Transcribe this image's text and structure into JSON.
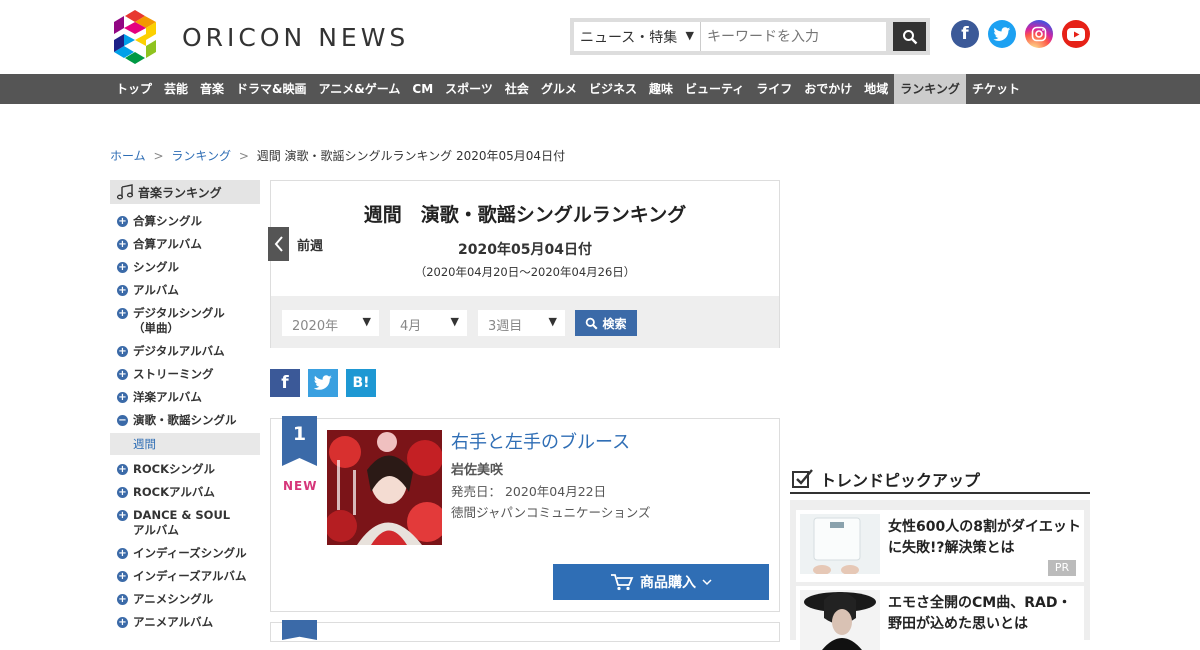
{
  "header": {
    "logo_text": "ORICON NEWS",
    "search": {
      "category": "ニュース・特集",
      "placeholder": "キーワードを入力"
    },
    "social": [
      {
        "name": "facebook",
        "glyph": "f",
        "color": "#3b5998"
      },
      {
        "name": "twitter",
        "glyph": "t",
        "color": "#1da1f2"
      },
      {
        "name": "instagram",
        "glyph": "◎",
        "color": "#c13584"
      },
      {
        "name": "youtube",
        "glyph": "▶",
        "color": "#e62117"
      }
    ]
  },
  "nav": {
    "items": [
      "トップ",
      "芸能",
      "音楽",
      "ドラマ&映画",
      "アニメ&ゲーム",
      "CM",
      "スポーツ",
      "社会",
      "グルメ",
      "ビジネス",
      "趣味",
      "ビューティ",
      "ライフ",
      "おでかけ",
      "地域",
      "ランキング",
      "チケット"
    ],
    "active_index": 15
  },
  "breadcrumb": {
    "home": "ホーム",
    "ranking": "ランキング",
    "current": "週間 演歌・歌謡シングルランキング 2020年05月04日付",
    "separator": ">"
  },
  "sidebar": {
    "heading": "音楽ランキング",
    "items": [
      {
        "label": "合算シングル",
        "symbol": "+"
      },
      {
        "label": "合算アルバム",
        "symbol": "+"
      },
      {
        "label": "シングル",
        "symbol": "+"
      },
      {
        "label": "アルバム",
        "symbol": "+"
      },
      {
        "label": "デジタルシングル（単曲）",
        "symbol": "+"
      },
      {
        "label": "デジタルアルバム",
        "symbol": "+"
      },
      {
        "label": "ストリーミング",
        "symbol": "+"
      },
      {
        "label": "洋楽アルバム",
        "symbol": "+"
      },
      {
        "label": "演歌・歌謡シングル",
        "symbol": "−",
        "sub": "週間"
      },
      {
        "label": "ROCKシングル",
        "symbol": "+"
      },
      {
        "label": "ROCKアルバム",
        "symbol": "+"
      },
      {
        "label": "DANCE & SOUL アルバム",
        "symbol": "+"
      },
      {
        "label": "インディーズシングル",
        "symbol": "+"
      },
      {
        "label": "インディーズアルバム",
        "symbol": "+"
      },
      {
        "label": "アニメシングル",
        "symbol": "+"
      },
      {
        "label": "アニメアルバム",
        "symbol": "+"
      }
    ]
  },
  "ranking": {
    "title": "週間　演歌・歌謡シングルランキング",
    "prev_label": "前週",
    "date": "2020年05月04日付",
    "range": "（2020年04月20日～2020年04月26日）",
    "filters": {
      "year": "2020年",
      "month": "4月",
      "week": "3週目",
      "search_label": "検索"
    }
  },
  "share": [
    {
      "name": "facebook",
      "glyph": "f",
      "color": "#3b5998"
    },
    {
      "name": "twitter",
      "glyph": "t",
      "color": "#3aa0e0"
    },
    {
      "name": "hatena",
      "glyph": "B!",
      "color": "#1e98d3"
    }
  ],
  "entries": [
    {
      "rank": "1",
      "badge": "NEW",
      "title": "右手と左手のブルース",
      "artist": "岩佐美咲",
      "release": "発売日：  2020年04月22日",
      "label": "徳間ジャパンコミュニケーションズ",
      "buy_label": "商品購入"
    }
  ],
  "trend": {
    "heading": "トレンドピックアップ",
    "items": [
      {
        "text": "女性600人の8割がダイエットに失敗!?解決策とは",
        "badge": "PR"
      },
      {
        "text": "エモさ全開のCM曲、RAD・野田が込めた思いとは"
      }
    ]
  }
}
